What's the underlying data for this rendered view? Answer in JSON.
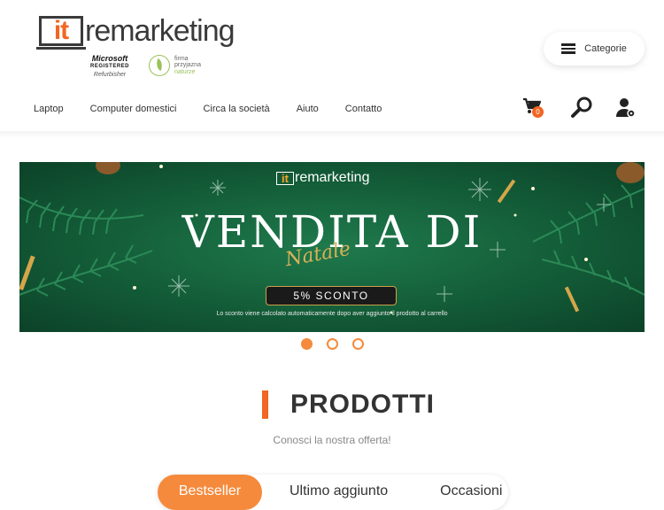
{
  "brand": {
    "logo_it": "it",
    "logo_rest": "remarketing",
    "ms_line1": "Microsoft",
    "ms_line2": "REGISTERED",
    "ms_line3": "Refurbisher",
    "eco_line1": "firma",
    "eco_line2": "przyjazna",
    "eco_line3": "naturze"
  },
  "header": {
    "categorie_label": "Categorie",
    "cart_count": "0"
  },
  "nav": {
    "items": [
      "Laptop",
      "Computer domestici",
      "Circa la società",
      "Aiuto",
      "Contatto"
    ]
  },
  "banner": {
    "logo_it": "it",
    "logo_rest": "remarketing",
    "title": "VENDITA DI",
    "script": "Natale",
    "pill": "5% SCONTO",
    "note": "Lo sconto viene calcolato automaticamente dopo aver aggiunto il prodotto al carrello",
    "accent_color": "#f58a3c"
  },
  "carousel": {
    "dots": 3,
    "active": 0
  },
  "products": {
    "title": "PRODOTTI",
    "subtitle": "Conosci la nostra offerta!",
    "tabs": [
      "Bestseller",
      "Ultimo aggiunto",
      "Occasioni"
    ]
  }
}
